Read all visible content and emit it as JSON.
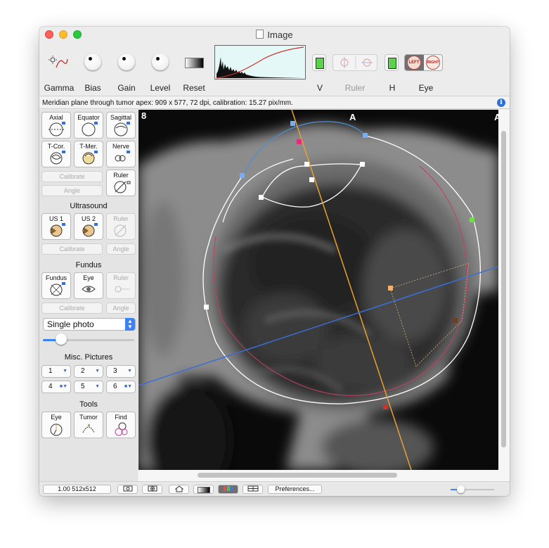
{
  "window": {
    "title": "Image"
  },
  "toolbar": {
    "labels": {
      "gamma": "Gamma",
      "bias": "Bias",
      "gain": "Gain",
      "level": "Level",
      "reset": "Reset",
      "v": "V",
      "ruler": "Ruler",
      "h": "H",
      "eye": "Eye"
    },
    "eye_left": "LEFT",
    "eye_right": "RIGHT"
  },
  "info": {
    "text": "Meridian plane through tumor apex: 909 x 577, 72 dpi, calibration: 15.27 pix/mm.",
    "icon": "i"
  },
  "sidebar": {
    "buttons": {
      "axial": "Axial",
      "equator": "Equator",
      "sagittal": "Sagittal",
      "tcor": "T-Cor.",
      "tmer": "T-Mer.",
      "nerve": "Nerve",
      "ruler": "Ruler",
      "us1": "US 1",
      "us2": "US 2",
      "fundus": "Fundus",
      "eye": "Eye",
      "tool_eye": "Eye",
      "tool_tumor": "Tumor",
      "tool_find": "Find"
    },
    "calibrate": "Calibrate",
    "angle": "Angle",
    "sections": {
      "ultrasound": "Ultrasound",
      "fundus": "Fundus",
      "misc": "Misc. Pictures",
      "tools": "Tools"
    },
    "photo_mode": "Single photo",
    "slider_value": 0.2,
    "pictures": [
      "1",
      "2",
      "3",
      "4",
      "5",
      "6"
    ]
  },
  "viewer": {
    "corner_label": "8",
    "top_label": "A",
    "right_label": "A"
  },
  "status": {
    "zoom": "1.00 512x512",
    "preferences": "Preferences..."
  },
  "colors": {
    "orange_axis": "#e8a030",
    "blue_axis": "#3a6fd8",
    "tumor_outline": "#c04060",
    "marker_pink": "#e0307a",
    "marker_green": "#6ee040",
    "marker_brown": "#6a4028",
    "marker_peach": "#f0b070",
    "marker_red": "#d03030"
  }
}
